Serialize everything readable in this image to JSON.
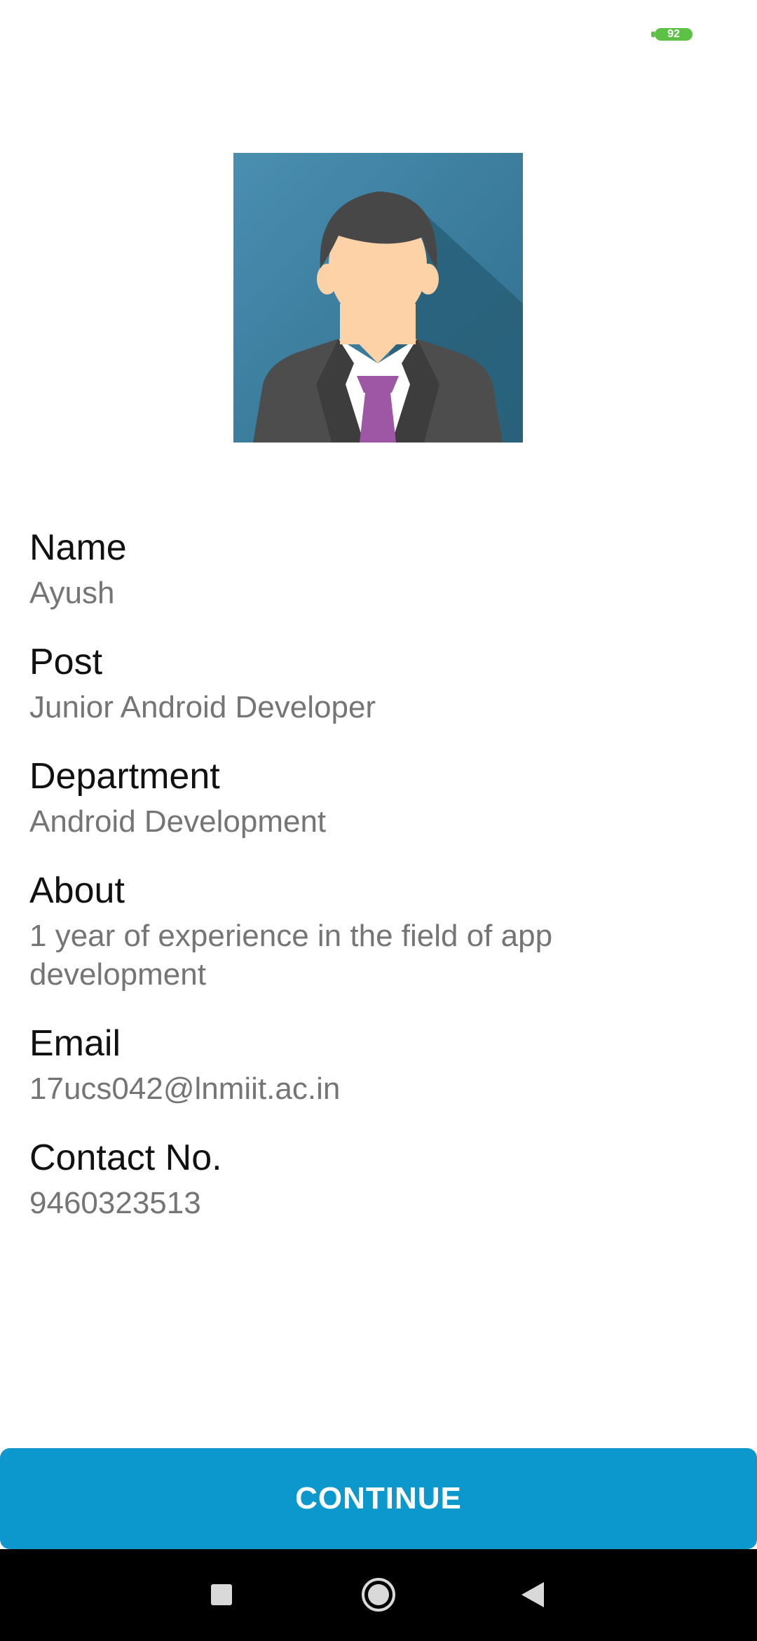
{
  "status_bar": {
    "battery_level": "92",
    "battery_color": "#5cc144"
  },
  "profile": {
    "avatar_icon": "businessman-avatar-icon",
    "fields": [
      {
        "label": "Name",
        "value": "Ayush"
      },
      {
        "label": "Post",
        "value": "Junior Android Developer"
      },
      {
        "label": "Department",
        "value": "Android Development"
      },
      {
        "label": "About",
        "value": "1 year of experience in the field of app development"
      },
      {
        "label": "Email",
        "value": "17ucs042@lnmiit.ac.in"
      },
      {
        "label": "Contact No.",
        "value": "9460323513"
      }
    ]
  },
  "actions": {
    "continue_label": "CONTINUE",
    "accent_color": "#0c98cc"
  },
  "nav_bar": {
    "recents_icon": "square-icon",
    "home_icon": "circle-home-icon",
    "back_icon": "triangle-back-icon"
  }
}
